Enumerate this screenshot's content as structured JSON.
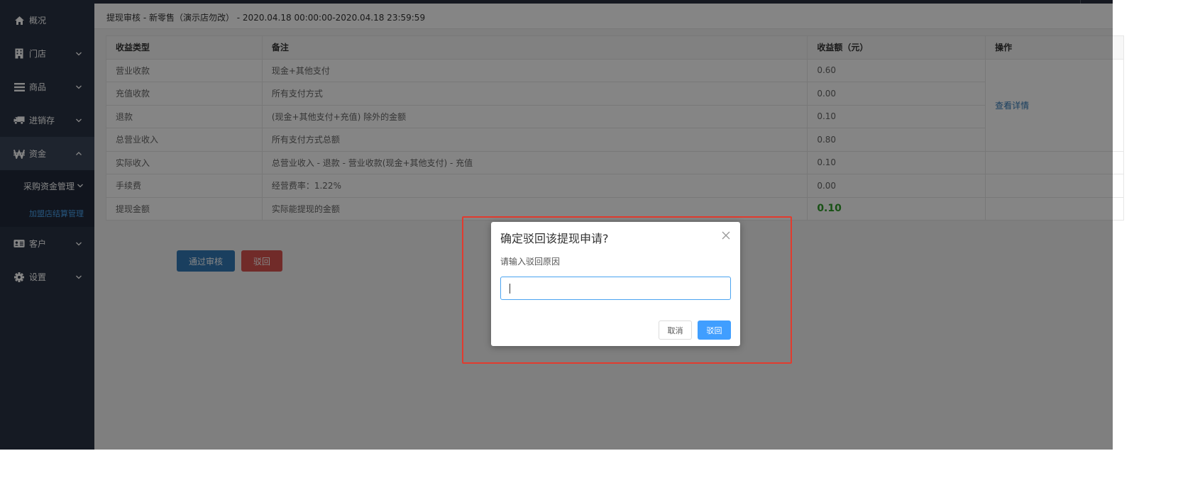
{
  "sidebar": {
    "items": [
      {
        "label": "概况",
        "icon": "home-icon"
      },
      {
        "label": "门店",
        "icon": "building-icon"
      },
      {
        "label": "商品",
        "icon": "list-icon"
      },
      {
        "label": "进销存",
        "icon": "truck-icon"
      },
      {
        "label": "资金",
        "icon": "won-currency-icon"
      },
      {
        "label": "客户",
        "icon": "id-card-icon"
      },
      {
        "label": "设置",
        "icon": "gear-icon"
      }
    ],
    "subitems": [
      {
        "label": "采购资金管理"
      },
      {
        "label": "加盟店结算管理"
      }
    ],
    "active_sub_color": "#4aa3f0"
  },
  "header": {
    "title": "提现审核 - 新零售（演示店勿改） - 2020.04.18 00:00:00-2020.04.18 23:59:59"
  },
  "table": {
    "headers": [
      "收益类型",
      "备注",
      "收益额（元）",
      "操作"
    ],
    "rows": [
      {
        "type": "营业收款",
        "note": "现金+其他支付",
        "amount": "0.60"
      },
      {
        "type": "充值收款",
        "note": "所有支付方式",
        "amount": "0.00"
      },
      {
        "type": "退款",
        "note": "(现金+其他支付+充值) 除外的金额",
        "amount": "0.10"
      },
      {
        "type": "总营业收入",
        "note": "所有支付方式总额",
        "amount": "0.80"
      },
      {
        "type": "实际收入",
        "note": "总营业收入 - 退款 - 营业收款(现金+其他支付) - 充值",
        "amount": "0.10"
      },
      {
        "type": "手续费",
        "note": "经营费率：1.22%",
        "amount": "0.00"
      },
      {
        "type": "提现金额",
        "note": "实际能提现的金额",
        "amount": "0.10"
      }
    ],
    "action_link": "查看详情"
  },
  "actions": {
    "pass": "通过审核",
    "reject": "驳回"
  },
  "modal": {
    "title": "确定驳回该提现申请?",
    "label": "请输入驳回原因",
    "input_value": "",
    "cancel": "取消",
    "confirm": "驳回"
  },
  "colors": {
    "sidebar_bg": "#2a3344",
    "primary": "#337ab7",
    "danger": "#d9534f",
    "modal_confirm": "#409eff",
    "highlight": "#e23b2e",
    "amount_green": "#2e9c2a"
  }
}
